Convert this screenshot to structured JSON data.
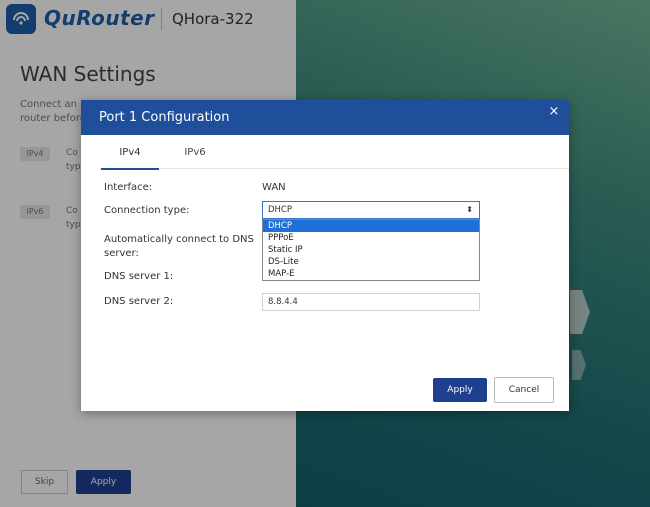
{
  "header": {
    "logo_text": "QuRouter",
    "model": "QHora-322"
  },
  "page": {
    "title": "WAN Settings",
    "desc_line1": "Connect an E",
    "desc_line2": "router before",
    "ipv4_badge": "IPv4",
    "ipv4_frag1": "Co",
    "ipv4_frag2": "typ",
    "ipv6_badge": "IPv6",
    "ipv6_frag1": "Co",
    "ipv6_frag2": "typ",
    "skip_label": "Skip",
    "apply_label": "Apply"
  },
  "modal": {
    "title": "Port 1 Configuration",
    "close_glyph": "×",
    "tabs": [
      {
        "label": "IPv4"
      },
      {
        "label": "IPv6"
      }
    ],
    "fields": {
      "interface_label": "Interface:",
      "interface_value": "WAN",
      "connection_type_label": "Connection type:",
      "connection_type_value": "DHCP",
      "auto_dns_label_line1": "Automatically connect to DNS",
      "auto_dns_label_line2": "server:",
      "dns1_label": "DNS server 1:",
      "dns2_label": "DNS server 2:",
      "dns2_value": "8.8.4.4"
    },
    "dropdown_options": [
      "DHCP",
      "PPPoE",
      "Static IP",
      "DS-Lite",
      "MAP-E"
    ],
    "apply_label": "Apply",
    "cancel_label": "Cancel"
  },
  "colors": {
    "accent": "#1f4e9b",
    "button_primary": "#1f3f8f",
    "option_highlight": "#1e6fd6"
  }
}
